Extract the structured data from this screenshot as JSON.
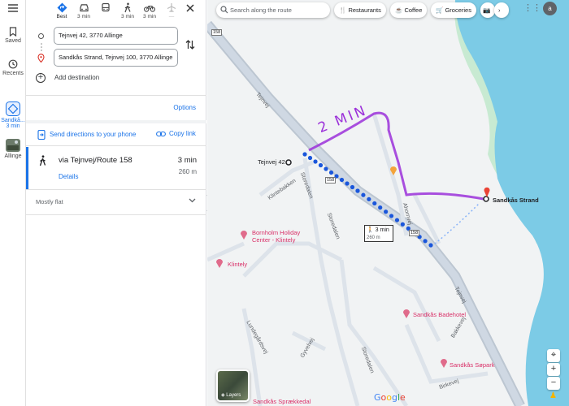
{
  "rail": {
    "menu_icon": "menu-icon",
    "saved": "Saved",
    "recents": "Recents",
    "directions_item": "Sandkå...",
    "directions_time": "3 min",
    "allinge": "Allinge"
  },
  "modes": {
    "best": "Best",
    "drive": "3 min",
    "transit": "",
    "walk": "3 min",
    "bike": "3 min",
    "flight": "—"
  },
  "waypoints": {
    "origin": "Tejnvej 42, 3770 Allinge",
    "destination": "Sandkås Strand, Tejnvej 100, 3770 Allinge",
    "add_destination": "Add destination"
  },
  "options_label": "Options",
  "send_label": "Send directions to your phone",
  "copy_label": "Copy link",
  "route": {
    "name": "via Tejnvej/Route 158",
    "time": "3 min",
    "distance": "260 m",
    "details": "Details"
  },
  "terrain": "Mostly flat",
  "map": {
    "search_placeholder": "Search along the route",
    "chips": [
      "Restaurants",
      "Coffee",
      "Groceries"
    ],
    "origin_label": "Tejnvej 42",
    "dest_label": "Sandkås Strand",
    "walk_time": "3 min",
    "walk_dist": "260 m",
    "annotation": "2 MIN",
    "road_158": "158",
    "street_tejnvej": "Tejnvej",
    "street_storedalen": "Storedalen",
    "street_klintebakken": "Klintebakken",
    "street_lundegardsvej": "Lundegårdsvej",
    "street_gyvelvej": "Gyvelvej",
    "street_birkevej": "Birkevej",
    "street_bakkevej": "Bakkevej",
    "street_ahornvej": "Ahornvej",
    "poi_bornholm_1": "Bornholm Holiday",
    "poi_bornholm_2": "Center - Klintely",
    "poi_klintely": "Klintely",
    "poi_hotel": "Sandkås Badehotel",
    "poi_sopark": "Sandkås Søpark",
    "poi_spraek": "Sandkås Sprækkedal",
    "layers": "Layers",
    "google": "Google",
    "user_initial": "a"
  },
  "colors": {
    "water": "#7ccbe6",
    "land": "#f1f3f4",
    "green": "#c8ead2",
    "route_dot": "#1a56db",
    "annotation": "#9b30d9",
    "accent": "#1a73e8",
    "pin": "#ea4335"
  }
}
